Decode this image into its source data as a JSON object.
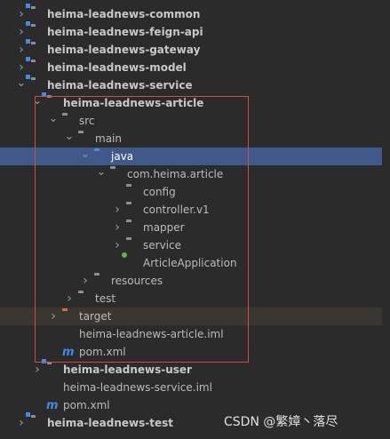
{
  "tree": {
    "rows": [
      {
        "label": "heima-leadnews-common",
        "icon": "module-folder-icon",
        "arrow": "right",
        "bold": true
      },
      {
        "label": "heima-leadnews-feign-api",
        "icon": "module-folder-icon",
        "arrow": "right",
        "bold": true
      },
      {
        "label": "heima-leadnews-gateway",
        "icon": "module-folder-icon",
        "arrow": "right",
        "bold": true
      },
      {
        "label": "heima-leadnews-model",
        "icon": "module-folder-icon",
        "arrow": "right",
        "bold": true
      },
      {
        "label": "heima-leadnews-service",
        "icon": "module-folder-icon",
        "arrow": "down",
        "bold": true
      },
      {
        "label": "heima-leadnews-article",
        "icon": "module-folder-icon",
        "arrow": "down",
        "bold": true
      },
      {
        "label": "src",
        "icon": "folder-icon",
        "arrow": "down"
      },
      {
        "label": "main",
        "icon": "folder-icon",
        "arrow": "down"
      },
      {
        "label": "java",
        "icon": "source-folder-icon",
        "arrow": "down",
        "selected": true
      },
      {
        "label": "com.heima.article",
        "icon": "package-icon",
        "arrow": "down"
      },
      {
        "label": "config",
        "icon": "package-icon",
        "arrow": "none"
      },
      {
        "label": "controller.v1",
        "icon": "package-icon",
        "arrow": "right"
      },
      {
        "label": "mapper",
        "icon": "package-icon",
        "arrow": "right"
      },
      {
        "label": "service",
        "icon": "package-icon",
        "arrow": "right"
      },
      {
        "label": "ArticleApplication",
        "icon": "spring-class-icon",
        "arrow": "none"
      },
      {
        "label": "resources",
        "icon": "resources-folder-icon",
        "arrow": "right"
      },
      {
        "label": "test",
        "icon": "folder-icon",
        "arrow": "right"
      },
      {
        "label": "target",
        "icon": "excluded-folder-icon",
        "arrow": "right",
        "excluded": true
      },
      {
        "label": "heima-leadnews-article.iml",
        "icon": "iml-file-icon",
        "arrow": "none"
      },
      {
        "label": "pom.xml",
        "icon": "maven-icon",
        "arrow": "none"
      },
      {
        "label": "heima-leadnews-user",
        "icon": "module-folder-icon",
        "arrow": "right",
        "bold": true
      },
      {
        "label": "heima-leadnews-service.iml",
        "icon": "iml-file-icon",
        "arrow": "none"
      },
      {
        "label": "pom.xml",
        "icon": "maven-icon",
        "arrow": "none"
      },
      {
        "label": "heima-leadnews-test",
        "icon": "module-folder-icon",
        "arrow": "right",
        "bold": true
      }
    ]
  },
  "watermark": "CSDN @繁嫜丶落尽",
  "colors": {
    "selection": "#3f5a8a",
    "highlight_box": "#d14b4b",
    "background": "#2b2b2b"
  }
}
